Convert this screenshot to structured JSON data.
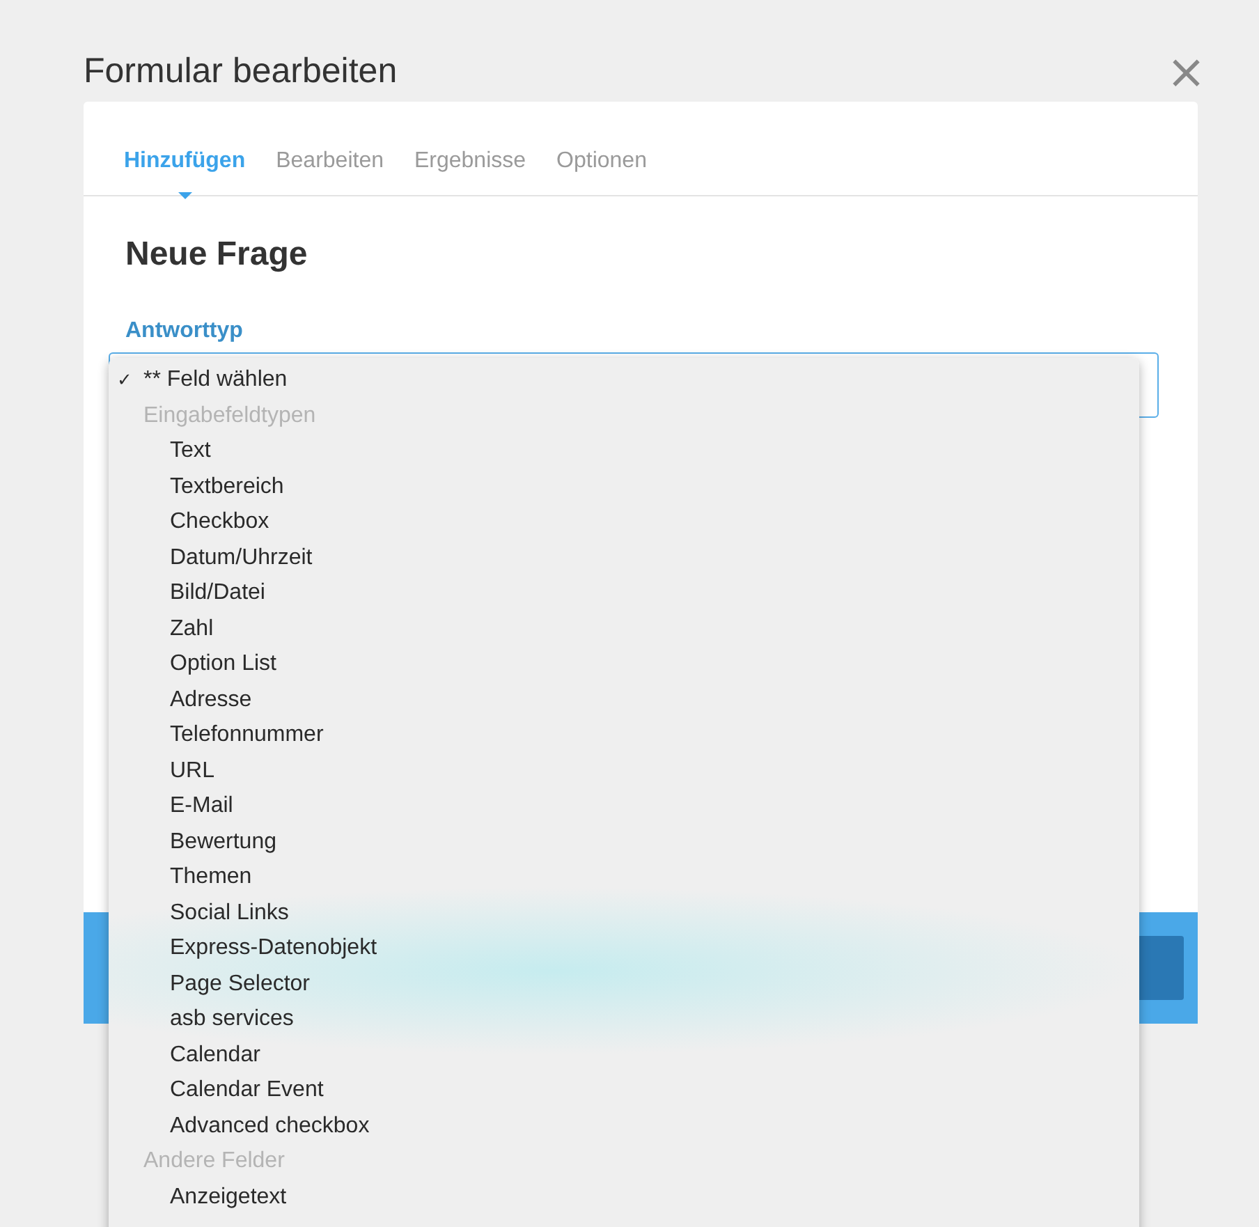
{
  "dialog": {
    "title": "Formular bearbeiten",
    "close_icon": "×"
  },
  "tabs": [
    {
      "label": "Hinzufügen",
      "selected": true
    },
    {
      "label": "Bearbeiten",
      "selected": false
    },
    {
      "label": "Ergebnisse",
      "selected": false
    },
    {
      "label": "Optionen",
      "selected": false
    }
  ],
  "form": {
    "heading": "Neue Frage",
    "field_label": "Antworttyp"
  },
  "dropdown": {
    "check_mark": "✓",
    "options": [
      {
        "kind": "top_option",
        "label": "** Feld wählen",
        "selected": true
      },
      {
        "kind": "group",
        "label": "Eingabefeldtypen"
      },
      {
        "kind": "option",
        "label": "Text",
        "selected": false
      },
      {
        "kind": "option",
        "label": "Textbereich",
        "selected": false
      },
      {
        "kind": "option",
        "label": "Checkbox",
        "selected": false
      },
      {
        "kind": "option",
        "label": "Datum/Uhrzeit",
        "selected": false
      },
      {
        "kind": "option",
        "label": "Bild/Datei",
        "selected": false
      },
      {
        "kind": "option",
        "label": "Zahl",
        "selected": false
      },
      {
        "kind": "option",
        "label": "Option List",
        "selected": false
      },
      {
        "kind": "option",
        "label": "Adresse",
        "selected": false
      },
      {
        "kind": "option",
        "label": "Telefonnummer",
        "selected": false
      },
      {
        "kind": "option",
        "label": "URL",
        "selected": false
      },
      {
        "kind": "option",
        "label": "E-Mail",
        "selected": false
      },
      {
        "kind": "option",
        "label": "Bewertung",
        "selected": false
      },
      {
        "kind": "option",
        "label": "Themen",
        "selected": false
      },
      {
        "kind": "option",
        "label": "Social Links",
        "selected": false
      },
      {
        "kind": "option",
        "label": "Express-Datenobjekt",
        "selected": false
      },
      {
        "kind": "option",
        "label": "Page Selector",
        "selected": false
      },
      {
        "kind": "option",
        "label": "asb services",
        "selected": false
      },
      {
        "kind": "option",
        "label": "Calendar",
        "selected": false
      },
      {
        "kind": "option",
        "label": "Calendar Event",
        "selected": false
      },
      {
        "kind": "option",
        "label": "Advanced checkbox",
        "selected": false
      },
      {
        "kind": "group",
        "label": "Andere Felder"
      },
      {
        "kind": "option",
        "label": "Anzeigetext",
        "selected": false
      }
    ]
  }
}
